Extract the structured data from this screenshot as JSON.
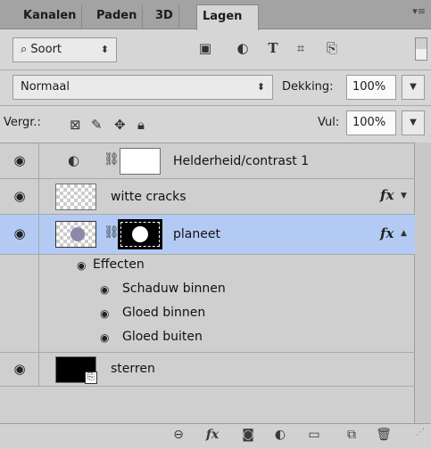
{
  "tabs": [
    {
      "label": "Kanalen"
    },
    {
      "label": "Paden"
    },
    {
      "label": "3D"
    },
    {
      "label": "Lagen"
    }
  ],
  "filter": {
    "search_glyph": "⌕",
    "kind_label": "Soort",
    "icons": [
      "image-filter-icon",
      "adjustment-filter-icon",
      "type-filter-icon",
      "shape-filter-icon",
      "smart-object-filter-icon"
    ]
  },
  "blend": {
    "mode": "Normaal",
    "opacity_label": "Dekking:",
    "opacity_value": "100%"
  },
  "lock": {
    "label": "Vergr.:",
    "fill_label": "Vul:",
    "fill_value": "100%"
  },
  "layers": [
    {
      "name": "Helderheid/contrast 1",
      "type": "adjustment"
    },
    {
      "name": "witte cracks",
      "fx": "fx"
    },
    {
      "name": "planeet",
      "fx": "fx",
      "selected": true
    },
    {
      "name": "sterren"
    }
  ],
  "effects": {
    "header": "Effecten",
    "items": [
      "Schaduw binnen",
      "Gloed binnen",
      "Gloed buiten"
    ]
  },
  "footer_icons": [
    "link-layers-icon",
    "fx-icon",
    "add-mask-icon",
    "adjustment-layer-icon",
    "new-group-icon",
    "new-layer-icon",
    "delete-layer-icon"
  ]
}
